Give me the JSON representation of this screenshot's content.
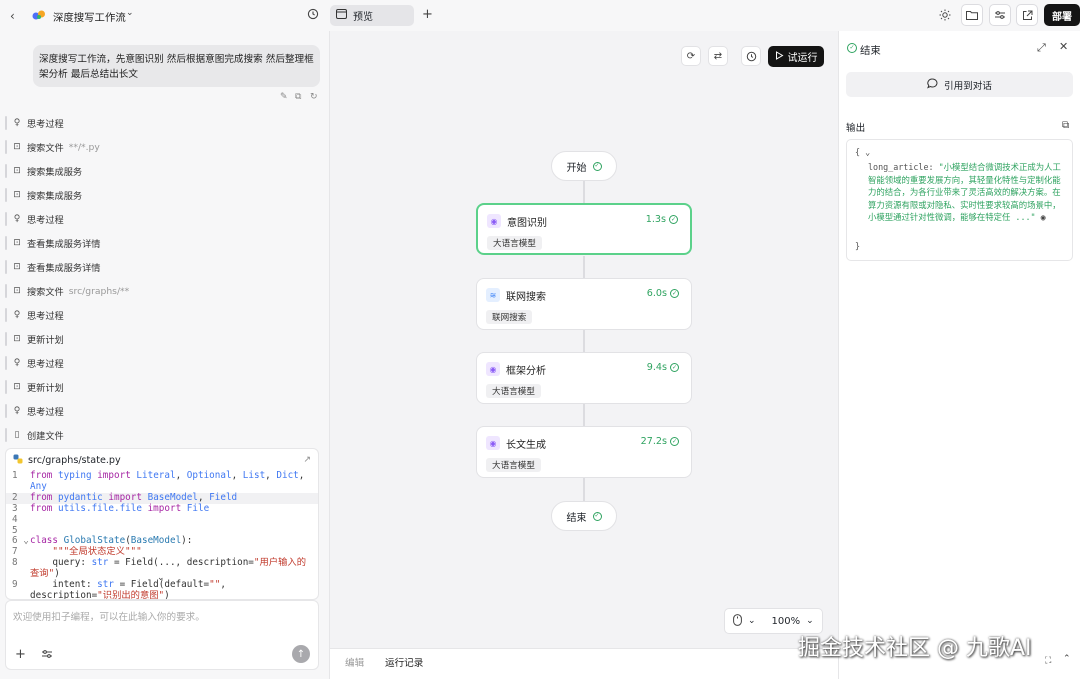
{
  "topbar": {
    "workflow_title": "深度搜写工作流",
    "preview_tab": "预览",
    "deploy_label": "部署"
  },
  "chat": {
    "user_message": "深度搜写工作流，先意图识别 然后根据意图完成搜索 然后整理框架分析 最后总结出长文",
    "steps": [
      {
        "icon": "bulb-icon",
        "label": "思考过程",
        "sub": ""
      },
      {
        "icon": "file-search-icon",
        "label": "搜索文件",
        "sub": "**/*.py"
      },
      {
        "icon": "file-search-icon",
        "label": "搜索集成服务",
        "sub": ""
      },
      {
        "icon": "file-search-icon",
        "label": "搜索集成服务",
        "sub": ""
      },
      {
        "icon": "bulb-icon",
        "label": "思考过程",
        "sub": ""
      },
      {
        "icon": "file-search-icon",
        "label": "查看集成服务详情",
        "sub": ""
      },
      {
        "icon": "file-search-icon",
        "label": "查看集成服务详情",
        "sub": ""
      },
      {
        "icon": "file-search-icon",
        "label": "搜索文件",
        "sub": "src/graphs/**"
      },
      {
        "icon": "bulb-icon",
        "label": "思考过程",
        "sub": ""
      },
      {
        "icon": "file-search-icon",
        "label": "更新计划",
        "sub": ""
      },
      {
        "icon": "bulb-icon",
        "label": "思考过程",
        "sub": ""
      },
      {
        "icon": "file-search-icon",
        "label": "更新计划",
        "sub": ""
      },
      {
        "icon": "bulb-icon",
        "label": "思考过程",
        "sub": ""
      },
      {
        "icon": "file-icon",
        "label": "创建文件",
        "sub": ""
      }
    ],
    "code_file": "src/graphs/state.py",
    "input_placeholder": "欢迎使用扣子编程，可以在此输入你的要求。"
  },
  "canvas": {
    "run_label": "试运行",
    "start_label": "开始",
    "end_label": "结束",
    "zoom": "100%",
    "nodes": [
      {
        "title": "意图识别",
        "time": "1.3s",
        "tag": "大语言模型"
      },
      {
        "title": "联网搜索",
        "time": "6.0s",
        "tag": "联网搜索"
      },
      {
        "title": "框架分析",
        "time": "9.4s",
        "tag": "大语言模型"
      },
      {
        "title": "长文生成",
        "time": "27.2s",
        "tag": "大语言模型"
      }
    ]
  },
  "bottom_tabs": {
    "edit": "编辑",
    "run_log": "运行记录"
  },
  "result": {
    "title": "结束",
    "cite_label": "引用到对话",
    "output_label": "输出",
    "key": "long_article",
    "value": "\"小模型结合微调技术正成为人工智能领域的重要发展方向，其轻量化特性与定制化能力的结合，为各行业带来了灵活高效的解决方案。在算力资源有限或对隐私、实时性要求较高的场景中，小模型通过针对性微调，能够在特定任 ...\""
  },
  "watermark": "掘金技术社区 @ 九歌AI",
  "colors": {
    "accent_green": "#2fa360",
    "active_border": "#5bd18a",
    "dark_button": "#141414"
  }
}
